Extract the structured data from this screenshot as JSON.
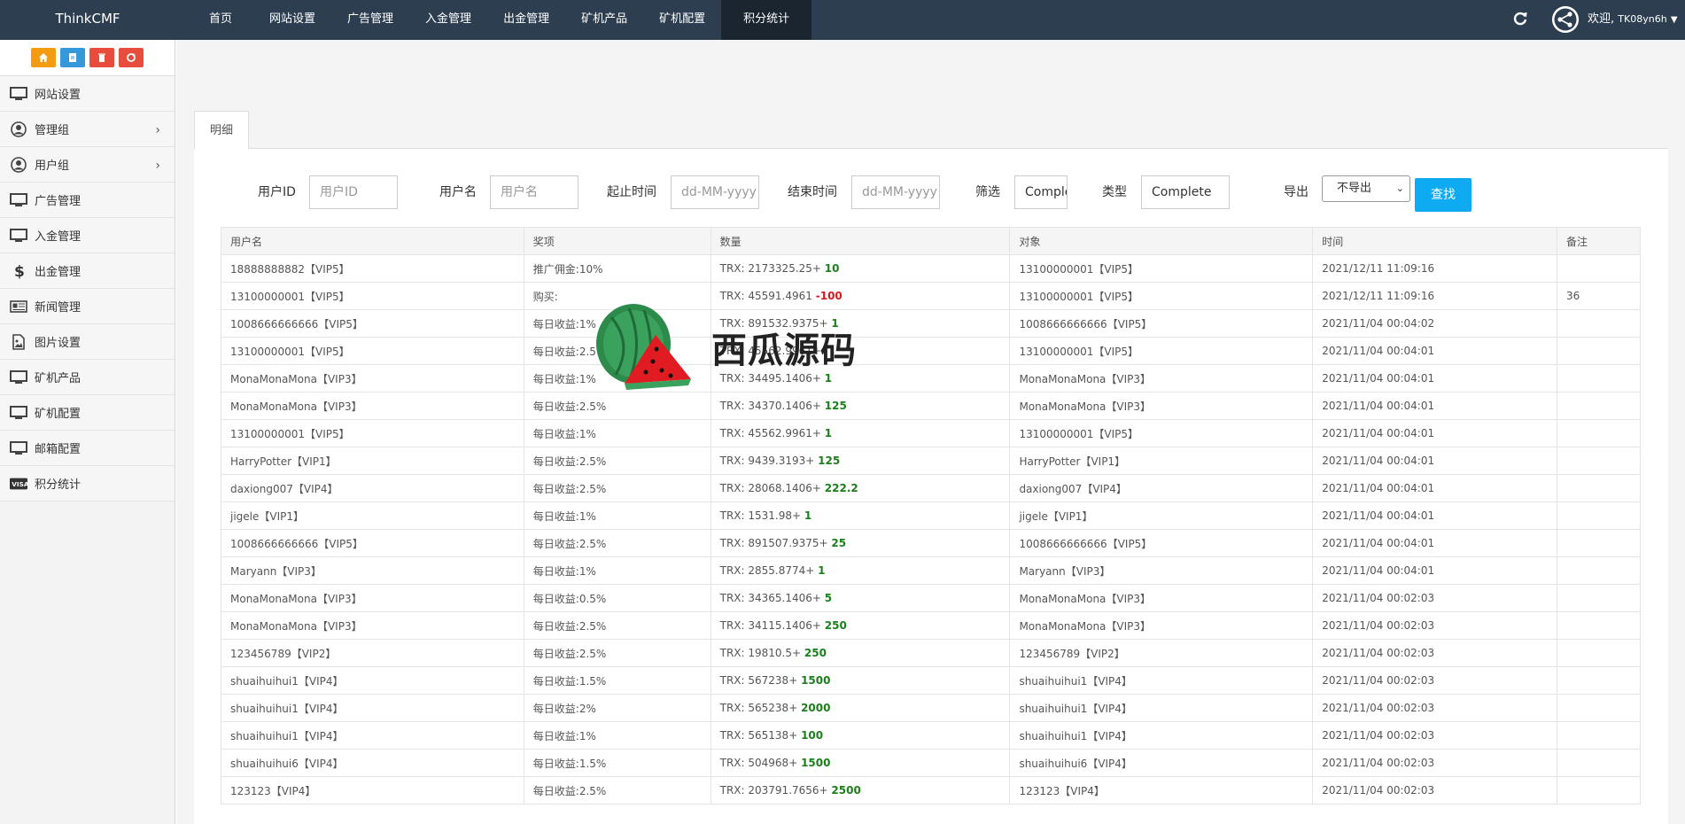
{
  "app": {
    "brand": "ThinkCMF"
  },
  "nav": [
    "首页",
    "网站设置",
    "广告管理",
    "入金管理",
    "出金管理",
    "矿机产品",
    "矿机配置",
    "积分统计"
  ],
  "nav_active_index": 7,
  "user": {
    "welcome": "欢迎,",
    "name": "TK08yn6h"
  },
  "sidebar": {
    "tools": [
      {
        "icon": "home-icon",
        "color": "#f39c12"
      },
      {
        "icon": "file-icon",
        "color": "#3498db"
      },
      {
        "icon": "trash-icon",
        "color": "#e74c3c"
      },
      {
        "icon": "recycle-icon",
        "color": "#e74c3c"
      }
    ],
    "items": [
      {
        "label": "网站设置",
        "icon": "monitor-icon",
        "arrow": false
      },
      {
        "label": "管理组",
        "icon": "user-circle-icon",
        "arrow": true
      },
      {
        "label": "用户组",
        "icon": "user-circle-icon",
        "arrow": true
      },
      {
        "label": "广告管理",
        "icon": "monitor-icon",
        "arrow": false
      },
      {
        "label": "入金管理",
        "icon": "monitor-icon",
        "arrow": false
      },
      {
        "label": "出金管理",
        "icon": "dollar-icon",
        "arrow": false
      },
      {
        "label": "新闻管理",
        "icon": "newspaper-icon",
        "arrow": false
      },
      {
        "label": "图片设置",
        "icon": "image-file-icon",
        "arrow": false
      },
      {
        "label": "矿机产品",
        "icon": "monitor-icon",
        "arrow": false
      },
      {
        "label": "矿机配置",
        "icon": "monitor-icon",
        "arrow": false
      },
      {
        "label": "邮箱配置",
        "icon": "monitor-icon",
        "arrow": false
      },
      {
        "label": "积分统计",
        "icon": "visa-icon",
        "arrow": false
      }
    ]
  },
  "tab": {
    "label": "明细"
  },
  "filter": {
    "user_id_label": "用户ID",
    "user_id_placeholder": "用户ID",
    "username_label": "用户名",
    "username_placeholder": "用户名",
    "start_label": "起止时间",
    "start_placeholder": "dd-MM-yyyy",
    "end_label": "结束时间",
    "end_placeholder": "dd-MM-yyyy",
    "filter_label": "筛选",
    "filter_value": "Comple",
    "type_label": "类型",
    "type_value": "Complete",
    "export_label": "导出",
    "export_value": "不导出",
    "search_button": "查找"
  },
  "table": {
    "headers": [
      "用户名",
      "奖项",
      "数量",
      "对象",
      "时间",
      "备注"
    ],
    "rows": [
      {
        "user": "18888888882【VIP5】",
        "item": "推广佣金:10%",
        "amount": "TRX: 2173325.25+ ",
        "delta": "10",
        "neg": false,
        "target": "13100000001【VIP5】",
        "time": "2021/12/11 11:09:16",
        "note": ""
      },
      {
        "user": "13100000001【VIP5】",
        "item": "购买:",
        "amount": "TRX: 45591.4961 ",
        "delta": "-100",
        "neg": true,
        "target": "13100000001【VIP5】",
        "time": "2021/12/11 11:09:16",
        "note": "36"
      },
      {
        "user": "1008666666666【VIP5】",
        "item": "每日收益:1%",
        "amount": "TRX: 891532.9375+ ",
        "delta": "1",
        "neg": false,
        "target": "1008666666666【VIP5】",
        "time": "2021/11/04 00:04:02",
        "note": ""
      },
      {
        "user": "13100000001【VIP5】",
        "item": "每日收益:2.5",
        "amount": "TRX: 45562.9961+ ",
        "delta": "",
        "neg": false,
        "target": "13100000001【VIP5】",
        "time": "2021/11/04 00:04:01",
        "note": ""
      },
      {
        "user": "MonaMonaMona【VIP3】",
        "item": "每日收益:1%",
        "amount": "TRX: 34495.1406+ ",
        "delta": "1",
        "neg": false,
        "target": "MonaMonaMona【VIP3】",
        "time": "2021/11/04 00:04:01",
        "note": ""
      },
      {
        "user": "MonaMonaMona【VIP3】",
        "item": "每日收益:2.5%",
        "amount": "TRX: 34370.1406+ ",
        "delta": "125",
        "neg": false,
        "target": "MonaMonaMona【VIP3】",
        "time": "2021/11/04 00:04:01",
        "note": ""
      },
      {
        "user": "13100000001【VIP5】",
        "item": "每日收益:1%",
        "amount": "TRX: 45562.9961+ ",
        "delta": "1",
        "neg": false,
        "target": "13100000001【VIP5】",
        "time": "2021/11/04 00:04:01",
        "note": ""
      },
      {
        "user": "HarryPotter【VIP1】",
        "item": "每日收益:2.5%",
        "amount": "TRX: 9439.3193+ ",
        "delta": "125",
        "neg": false,
        "target": "HarryPotter【VIP1】",
        "time": "2021/11/04 00:04:01",
        "note": ""
      },
      {
        "user": "daxiong007【VIP4】",
        "item": "每日收益:2.5%",
        "amount": "TRX: 28068.1406+ ",
        "delta": "222.2",
        "neg": false,
        "target": "daxiong007【VIP4】",
        "time": "2021/11/04 00:04:01",
        "note": ""
      },
      {
        "user": "jigele【VIP1】",
        "item": "每日收益:1%",
        "amount": "TRX: 1531.98+ ",
        "delta": "1",
        "neg": false,
        "target": "jigele【VIP1】",
        "time": "2021/11/04 00:04:01",
        "note": ""
      },
      {
        "user": "1008666666666【VIP5】",
        "item": "每日收益:2.5%",
        "amount": "TRX: 891507.9375+ ",
        "delta": "25",
        "neg": false,
        "target": "1008666666666【VIP5】",
        "time": "2021/11/04 00:04:01",
        "note": ""
      },
      {
        "user": "Maryann【VIP3】",
        "item": "每日收益:1%",
        "amount": "TRX: 2855.8774+ ",
        "delta": "1",
        "neg": false,
        "target": "Maryann【VIP3】",
        "time": "2021/11/04 00:04:01",
        "note": ""
      },
      {
        "user": "MonaMonaMona【VIP3】",
        "item": "每日收益:0.5%",
        "amount": "TRX: 34365.1406+ ",
        "delta": "5",
        "neg": false,
        "target": "MonaMonaMona【VIP3】",
        "time": "2021/11/04 00:02:03",
        "note": ""
      },
      {
        "user": "MonaMonaMona【VIP3】",
        "item": "每日收益:2.5%",
        "amount": "TRX: 34115.1406+ ",
        "delta": "250",
        "neg": false,
        "target": "MonaMonaMona【VIP3】",
        "time": "2021/11/04 00:02:03",
        "note": ""
      },
      {
        "user": "123456789【VIP2】",
        "item": "每日收益:2.5%",
        "amount": "TRX: 19810.5+ ",
        "delta": "250",
        "neg": false,
        "target": "123456789【VIP2】",
        "time": "2021/11/04 00:02:03",
        "note": ""
      },
      {
        "user": "shuaihuihui1【VIP4】",
        "item": "每日收益:1.5%",
        "amount": "TRX: 567238+ ",
        "delta": "1500",
        "neg": false,
        "target": "shuaihuihui1【VIP4】",
        "time": "2021/11/04 00:02:03",
        "note": ""
      },
      {
        "user": "shuaihuihui1【VIP4】",
        "item": "每日收益:2%",
        "amount": "TRX: 565238+ ",
        "delta": "2000",
        "neg": false,
        "target": "shuaihuihui1【VIP4】",
        "time": "2021/11/04 00:02:03",
        "note": ""
      },
      {
        "user": "shuaihuihui1【VIP4】",
        "item": "每日收益:1%",
        "amount": "TRX: 565138+ ",
        "delta": "100",
        "neg": false,
        "target": "shuaihuihui1【VIP4】",
        "time": "2021/11/04 00:02:03",
        "note": ""
      },
      {
        "user": "shuaihuihui6【VIP4】",
        "item": "每日收益:1.5%",
        "amount": "TRX: 504968+ ",
        "delta": "1500",
        "neg": false,
        "target": "shuaihuihui6【VIP4】",
        "time": "2021/11/04 00:02:03",
        "note": ""
      },
      {
        "user": "123123【VIP4】",
        "item": "每日收益:2.5%",
        "amount": "TRX: 203791.7656+ ",
        "delta": "2500",
        "neg": false,
        "target": "123123【VIP4】",
        "time": "2021/11/04 00:02:03",
        "note": ""
      }
    ]
  },
  "watermark": {
    "text": "西瓜源码"
  },
  "colors": {
    "topbar": "#2c3e50",
    "active_nav": "#1a252f",
    "search_button": "#0eaaf2",
    "positive": "#1b7f1b",
    "negative": "#d9181e"
  }
}
